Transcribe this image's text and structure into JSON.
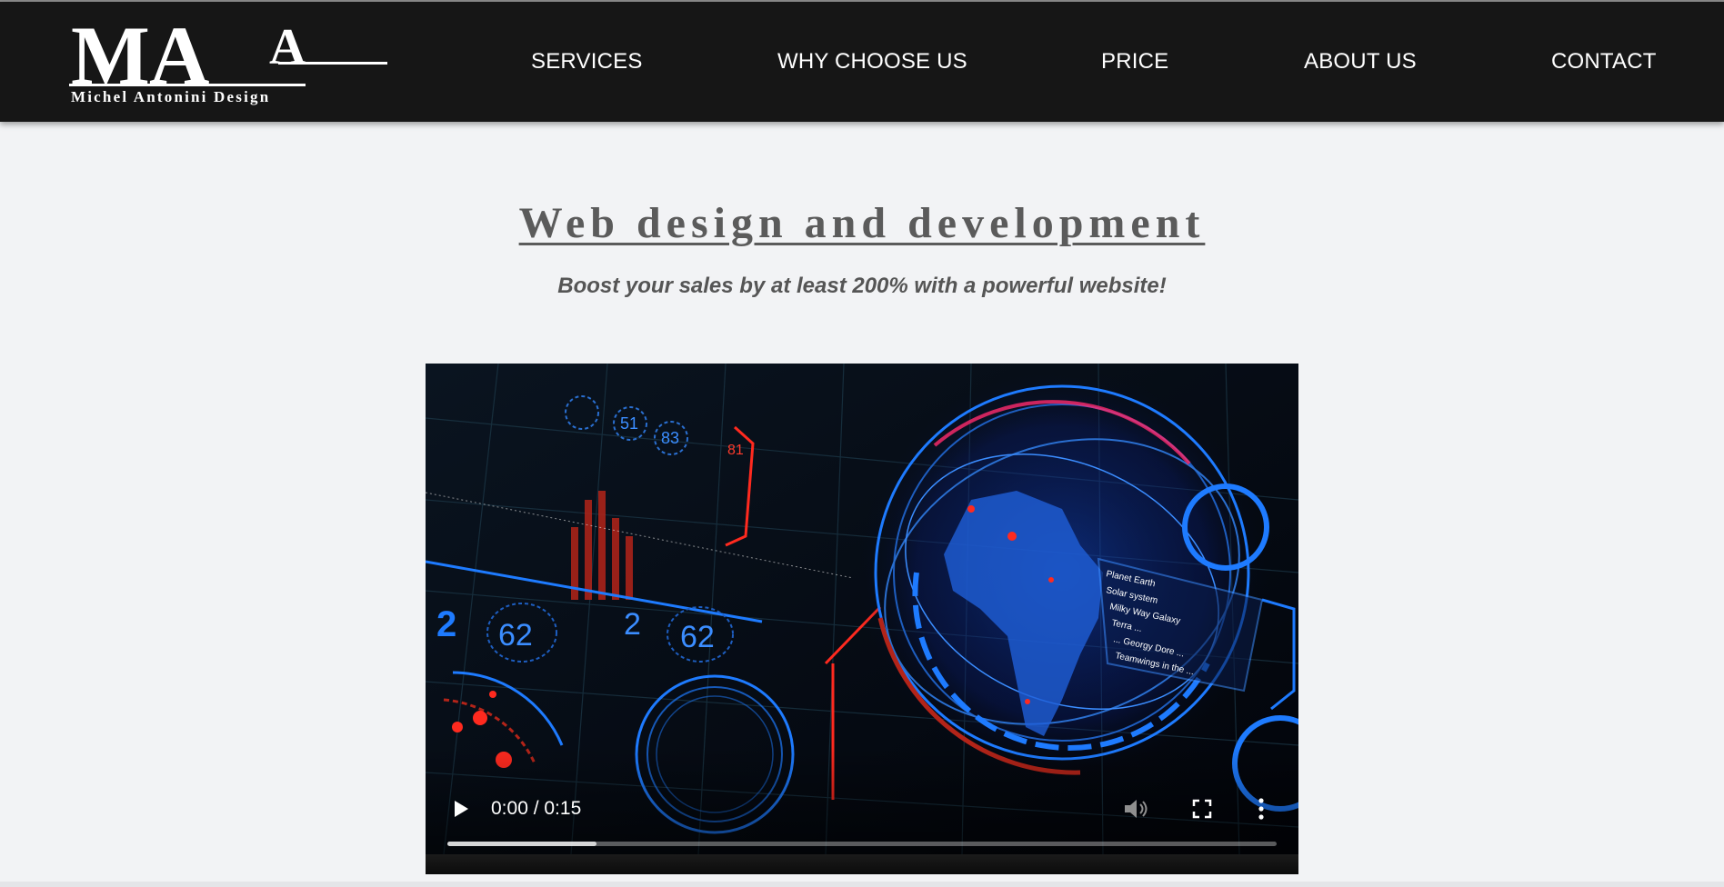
{
  "brand": {
    "logo_mark": "MA",
    "logo_text": "Michel Antonini Design"
  },
  "nav": {
    "items": [
      {
        "label": "SERVICES"
      },
      {
        "label": "WHY CHOOSE US"
      },
      {
        "label": "PRICE"
      },
      {
        "label": "ABOUT US"
      },
      {
        "label": "CONTACT"
      }
    ]
  },
  "hero": {
    "title": "Web design and development",
    "subtitle": "Boost your sales by at least 200% with a powerful website!"
  },
  "video": {
    "time_display": "0:00 / 0:15",
    "buffered_fraction": 0.18,
    "hud_numbers": [
      "62",
      "2",
      "62",
      "2",
      "51",
      "83",
      "81"
    ],
    "overlay_lines": [
      "Planet Earth",
      "Solar system",
      "Milky Way Galaxy",
      "Terra ...",
      "... Georgy Dore ...",
      "Teamwings in the ..."
    ],
    "icons": {
      "play": "play-icon",
      "mute": "volume-muted-icon",
      "fullscreen": "fullscreen-icon",
      "more": "more-vertical-icon"
    }
  },
  "colors": {
    "navbar_bg": "#161616",
    "page_bg": "#f2f3f5",
    "title_color": "#5b5b5b",
    "hud_blue": "#1e7bff",
    "hud_red": "#ff2a1f"
  }
}
